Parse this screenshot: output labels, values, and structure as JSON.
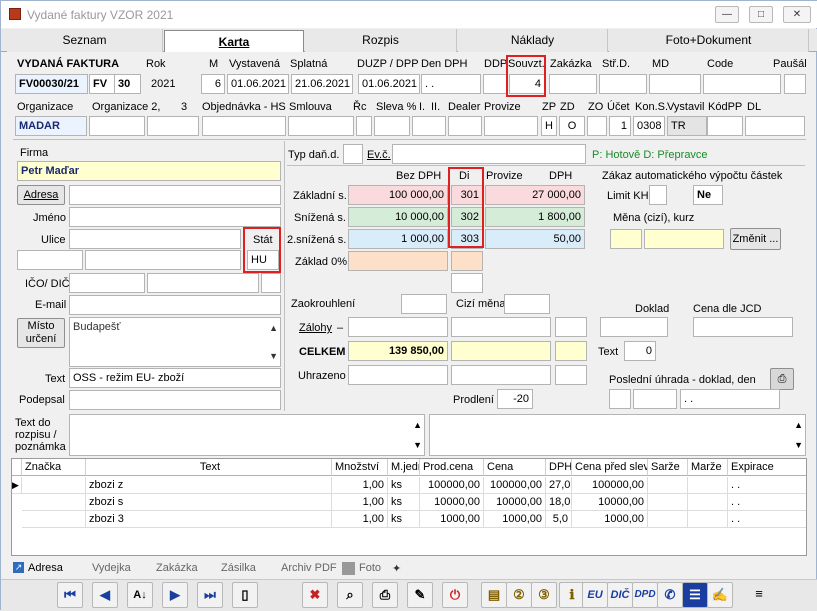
{
  "window": {
    "title": "Vydané faktury VZOR  2021"
  },
  "tabs": [
    "Seznam",
    "Karta",
    "Rozpis",
    "Náklady",
    "Foto+Dokument"
  ],
  "header": {
    "labels": {
      "vydana_faktura": "VYDANÁ FAKTURA",
      "rok": "Rok",
      "m": "M",
      "vystavena": "Vystavená",
      "splatna": "Splatná",
      "duzp": "DUZP / DPP",
      "den_dph": "Den DPH",
      "ddp": "DDP",
      "souvzt": "Souvzt.",
      "zakazka": "Zakázka",
      "strd": "Stř.D.",
      "md": "MD",
      "code": "Code",
      "pausal": "Paušál"
    },
    "values": {
      "cislo": "FV00030/21",
      "rada": "FV",
      "rada_num": "30",
      "rok": "2021",
      "m": "6",
      "vystavena": "01.06.2021",
      "splatna": "21.06.2021",
      "duzp": "01.06.2021",
      "den_dph": ". .",
      "souvzt": "4"
    }
  },
  "org": {
    "labels": {
      "organizace": "Organizace",
      "organizace2": "Organizace  2,",
      "n3": "3",
      "objednavka": "Objednávka - HS",
      "smlouva": "Smlouva",
      "rc": "Řc",
      "sleva": "Sleva %",
      "i": "I.",
      "ii": "II.",
      "dealer": "Dealer",
      "provize": "Provize",
      "zp": "ZP",
      "zd": "ZD",
      "zo": "ZO",
      "ucet": "Účet",
      "kon": "Kon.S.",
      "vystavil": "Vystavil",
      "kodpp": "KódPP",
      "dl": "DL"
    },
    "values": {
      "organizace": "MADAR",
      "zp": "H",
      "zd": "O",
      "ucet": "1",
      "kon": "0308",
      "vystavil": "TR"
    }
  },
  "firma": {
    "labels": {
      "firma": "Firma",
      "adresa": "Adresa",
      "jmeno": "Jméno",
      "ulice": "Ulice",
      "stat": "Stát",
      "ico_dic": "IČO/ DIČ",
      "email": "E-mail",
      "misto_urceni": "Místo určení",
      "text": "Text",
      "podepsal": "Podepsal"
    },
    "values": {
      "firma": "Petr Maďar",
      "stat": "HU",
      "misto": "Budapešť",
      "text": "OSS - režim EU- zboží"
    }
  },
  "tax": {
    "labels": {
      "typ_dan": "Typ daň.d.",
      "ev_c": "Ev.č.",
      "hotove": "P: Hotově  D: Přepravce",
      "bez_dph": "Bez DPH",
      "di": "Di",
      "provize": "Provize",
      "dph": "DPH",
      "zakaz": "Zákaz automatického výpočtu částek",
      "zakladni": "Základní s.",
      "snizena": "Snížená s.",
      "snizena2": "2.snížená s.",
      "zaklad0": "Základ 0%",
      "limit_kh": "Limit KH",
      "mena": "Měna (cizí), kurz",
      "zmenit": "Změnit ...",
      "zaokrouhleni": "Zaokrouhlení",
      "cizi_mena": "Cizí měna",
      "zalohy": "Zálohy",
      "dash": "–",
      "doklad": "Doklad",
      "cena_jcd": "Cena dle JCD",
      "celkem": "CELKEM",
      "text": "Text",
      "uhrazeno": "Uhrazeno",
      "posledni": "Poslední úhrada - doklad, den",
      "prodleni": "Prodlení"
    },
    "rows": [
      {
        "bez": "100 000,00",
        "di": "301",
        "dph": "27 000,00"
      },
      {
        "bez": "10 000,00",
        "di": "302",
        "dph": "1 800,00"
      },
      {
        "bez": "1 000,00",
        "di": "303",
        "dph": "50,00"
      }
    ],
    "values": {
      "ne": "Ne",
      "celkem": "139 850,00",
      "text_num": "0",
      "prodleni": "-20",
      "posledni_den": ". ."
    }
  },
  "rozpis": {
    "label": "Text do rozpisu / poznámka"
  },
  "table": {
    "columns": [
      "Značka",
      "Text",
      "Množství",
      "M.jedn",
      "Prod.cena",
      "Cena",
      "DPH",
      "Cena před slev",
      "Sarže",
      "Marže",
      "Expirace"
    ],
    "rows": [
      [
        "",
        "zbozi z",
        "1,00",
        "ks",
        "100000,00",
        "100000,00",
        "27,0",
        "100000,00",
        "",
        "",
        ". ."
      ],
      [
        "",
        "zbozi s",
        "1,00",
        "ks",
        "10000,00",
        "10000,00",
        "18,0",
        "10000,00",
        "",
        "",
        ". ."
      ],
      [
        "",
        "zbozi 3",
        "1,00",
        "ks",
        "1000,00",
        "1000,00",
        "5,0",
        "1000,00",
        "",
        "",
        ". ."
      ]
    ]
  },
  "bottom_tabs": [
    "Adresa",
    "Vydejka",
    "Zakázka",
    "Zásilka",
    "Archiv PDF",
    "Foto"
  ],
  "toolbar": [
    "first-icon",
    "prev-icon",
    "sort-icon",
    "next-icon",
    "last-icon",
    "new-icon",
    "delete-icon",
    "find-icon",
    "print-icon",
    "edit-icon",
    "close-icon",
    "doc1-icon",
    "doc2-icon",
    "doc3-icon",
    "info-icon",
    "EU",
    "DIČ",
    "DPD",
    "post-icon",
    "calc-icon",
    "sign-icon",
    "menu-icon"
  ]
}
